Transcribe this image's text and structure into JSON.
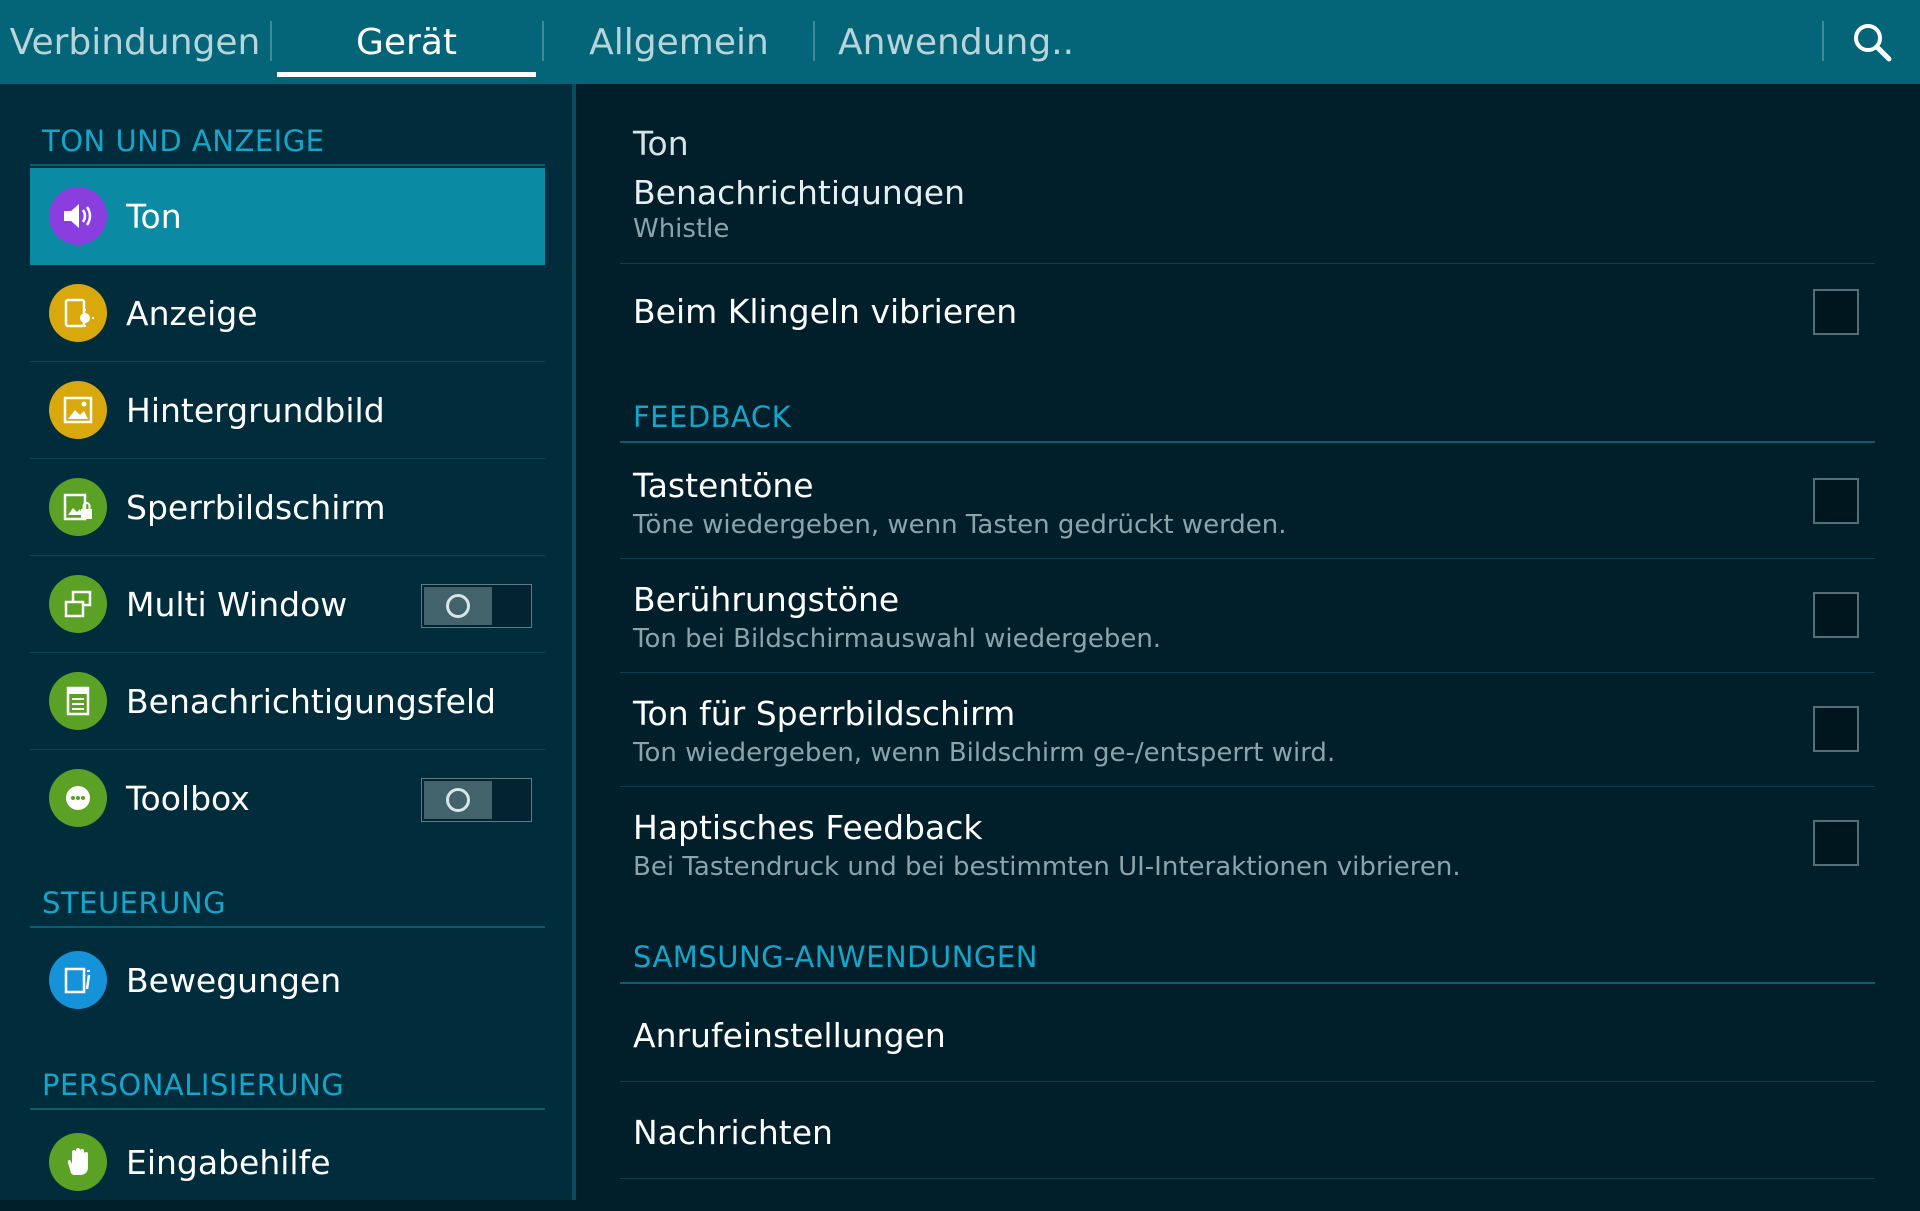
{
  "tabs": [
    {
      "label": "Verbindungen",
      "active": false
    },
    {
      "label": "Gerät",
      "active": true
    },
    {
      "label": "Allgemein",
      "active": false
    },
    {
      "label": "Anwendung..",
      "active": false
    }
  ],
  "colors": {
    "topbar": "#056578",
    "accent": "#14a5c8",
    "selected_item": "#0b8aa3",
    "sidebar_bg": "#012c3b",
    "main_bg": "#001f2a"
  },
  "sidebar": {
    "sections": [
      {
        "title": "TON UND ANZEIGE",
        "items": [
          {
            "label": "Ton",
            "icon": "speaker-icon",
            "icon_color": "#8a3ee0",
            "selected": true
          },
          {
            "label": "Anzeige",
            "icon": "display-icon",
            "icon_color": "#d8a80c"
          },
          {
            "label": "Hintergrundbild",
            "icon": "wallpaper-icon",
            "icon_color": "#d8a80c"
          },
          {
            "label": "Sperrbildschirm",
            "icon": "lockscreen-icon",
            "icon_color": "#5ba125"
          },
          {
            "label": "Multi Window",
            "icon": "multi-window-icon",
            "icon_color": "#5ba125",
            "toggle": "off"
          },
          {
            "label": "Benachrichtigungsfeld",
            "icon": "notification-panel-icon",
            "icon_color": "#5ba125"
          },
          {
            "label": "Toolbox",
            "icon": "toolbox-icon",
            "icon_color": "#5ba125",
            "toggle": "off"
          }
        ]
      },
      {
        "title": "STEUERUNG",
        "items": [
          {
            "label": "Bewegungen",
            "icon": "motions-icon",
            "icon_color": "#1592d8"
          }
        ]
      },
      {
        "title": "PERSONALISIERUNG",
        "items": [
          {
            "label": "Eingabehilfe",
            "icon": "hand-icon",
            "icon_color": "#5ba125"
          }
        ]
      }
    ]
  },
  "main": {
    "header": "Ton",
    "partial_item": {
      "title": "Benachrichtigungen",
      "subtitle": "Whistle"
    },
    "vibrate_item": {
      "title": "Beim Klingeln vibrieren",
      "checked": false
    },
    "feedback_section": {
      "title": "FEEDBACK",
      "items": [
        {
          "title": "Tastentöne",
          "subtitle": "Töne wiedergeben, wenn Tasten gedrückt werden.",
          "checked": false
        },
        {
          "title": "Berührungstöne",
          "subtitle": "Ton bei Bildschirmauswahl wiedergeben.",
          "checked": false
        },
        {
          "title": "Ton für Sperrbildschirm",
          "subtitle": "Ton wiedergeben, wenn Bildschirm ge-/entsperrt wird.",
          "checked": false
        },
        {
          "title": "Haptisches Feedback",
          "subtitle": "Bei Tastendruck und bei bestimmten UI-Interaktionen vibrieren.",
          "checked": false
        }
      ]
    },
    "samsung_section": {
      "title": "SAMSUNG-ANWENDUNGEN",
      "items": [
        {
          "title": "Anrufeinstellungen"
        },
        {
          "title": "Nachrichten"
        }
      ]
    }
  }
}
